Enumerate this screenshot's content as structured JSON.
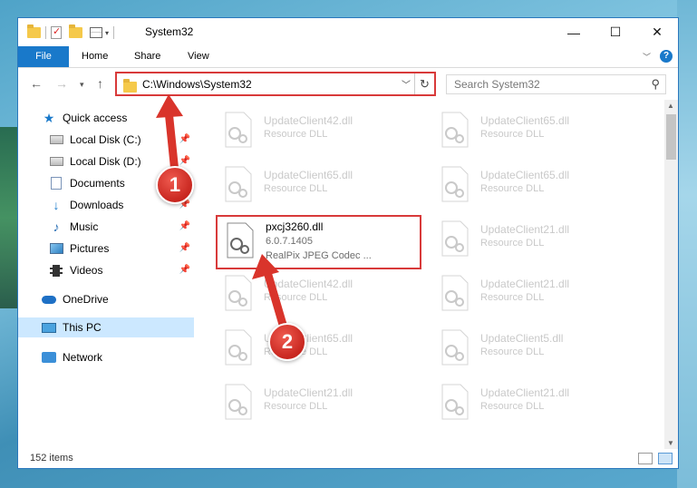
{
  "window": {
    "title": "System32",
    "controls": {
      "minimize": "—",
      "maximize": "☐",
      "close": "✕"
    }
  },
  "ribbon": {
    "tabs": [
      {
        "label": "File"
      },
      {
        "label": "Home"
      },
      {
        "label": "Share"
      },
      {
        "label": "View"
      }
    ]
  },
  "address": {
    "path": "C:\\Windows\\System32",
    "search_placeholder": "Search System32"
  },
  "sidebar": {
    "items": [
      {
        "label": "Quick access",
        "icon": "star-icon"
      },
      {
        "label": "Local Disk (C:)",
        "icon": "drive-icon",
        "pinned": true
      },
      {
        "label": "Local Disk (D:)",
        "icon": "drive-icon",
        "pinned": true
      },
      {
        "label": "Documents",
        "icon": "documents-icon",
        "pinned": true
      },
      {
        "label": "Downloads",
        "icon": "download-icon",
        "pinned": true
      },
      {
        "label": "Music",
        "icon": "music-icon",
        "pinned": true
      },
      {
        "label": "Pictures",
        "icon": "pictures-icon",
        "pinned": true
      },
      {
        "label": "Videos",
        "icon": "videos-icon",
        "pinned": true
      },
      {
        "label": "OneDrive",
        "icon": "cloud-icon"
      },
      {
        "label": "This PC",
        "icon": "computer-icon",
        "selected": true
      },
      {
        "label": "Network",
        "icon": "network-icon"
      }
    ]
  },
  "files": [
    {
      "name": "UpdateClient42.dll",
      "desc": "Resource DLL"
    },
    {
      "name": "UpdateClient65.dll",
      "desc": "Resource DLL"
    },
    {
      "name": "UpdateClient65.dll",
      "desc": "Resource DLL"
    },
    {
      "name": "UpdateClient65.dll",
      "desc": "Resource DLL"
    },
    {
      "name": "pxcj3260.dll",
      "version": "6.0.7.1405",
      "desc": "RealPix JPEG Codec ...",
      "highlighted": true
    },
    {
      "name": "UpdateClient21.dll",
      "desc": "Resource DLL"
    },
    {
      "name": "UpdateClient42.dll",
      "desc": "Resource DLL"
    },
    {
      "name": "UpdateClient21.dll",
      "desc": "Resource DLL"
    },
    {
      "name": "UpdateClient65.dll",
      "desc": "Resource DLL"
    },
    {
      "name": "UpdateClient5.dll",
      "desc": "Resource DLL"
    },
    {
      "name": "UpdateClient21.dll",
      "desc": "Resource DLL"
    },
    {
      "name": "UpdateClient21.dll",
      "desc": "Resource DLL"
    }
  ],
  "status": {
    "item_count": "152 items"
  },
  "annotations": {
    "step1": "1",
    "step2": "2"
  },
  "colors": {
    "highlight": "#d83a3a",
    "accent": "#1979ca",
    "selected": "#cce8ff"
  }
}
